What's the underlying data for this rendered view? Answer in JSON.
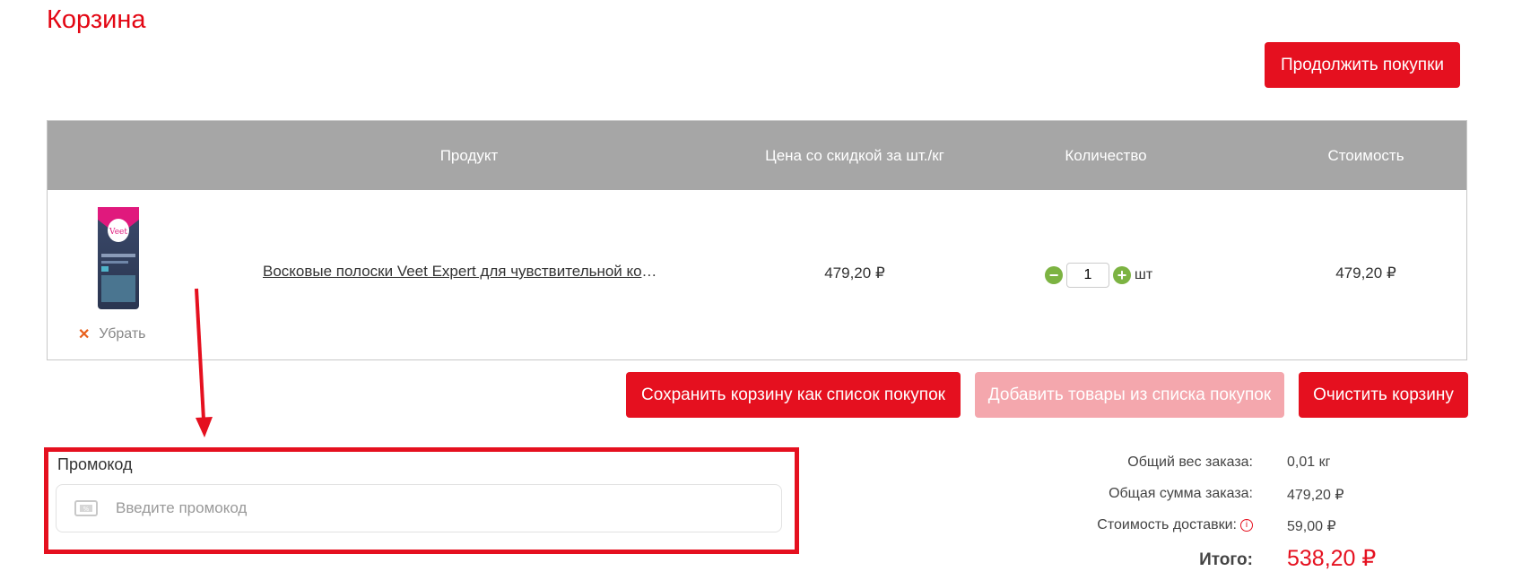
{
  "page": {
    "title": "Корзина"
  },
  "actions": {
    "continue_shopping": "Продолжить покупки",
    "save_as_list": "Сохранить корзину как список покупок",
    "add_from_list": "Добавить товары из списка покупок",
    "clear_cart": "Очистить корзину"
  },
  "table": {
    "headers": [
      "Продукт",
      "Цена со скидкой за шт./кг",
      "Количество",
      "Стоимость"
    ],
    "items": [
      {
        "name": "Восковые полоски Veet Expert для чувствительной кожи",
        "unit_price": "479,20 ₽",
        "quantity": "1",
        "unit": "шт",
        "line_total": "479,20 ₽",
        "remove_label": "Убрать",
        "image_text": "Veet"
      }
    ]
  },
  "promo": {
    "label": "Промокод",
    "placeholder": "Введите промокод"
  },
  "summary": {
    "weight_label": "Общий вес заказа:",
    "weight_value": "0,01 кг",
    "subtotal_label": "Общая сумма заказа:",
    "subtotal_value": "479,20 ₽",
    "delivery_label": "Стоимость доставки:",
    "delivery_value": "59,00 ₽",
    "total_label": "Итого:",
    "total_value": "538,20 ₽"
  },
  "colors": {
    "accent": "#e5101f",
    "accent_disabled": "#f4a7ad",
    "header_bg": "#a6a6a6",
    "qty_button": "#7cb342"
  }
}
